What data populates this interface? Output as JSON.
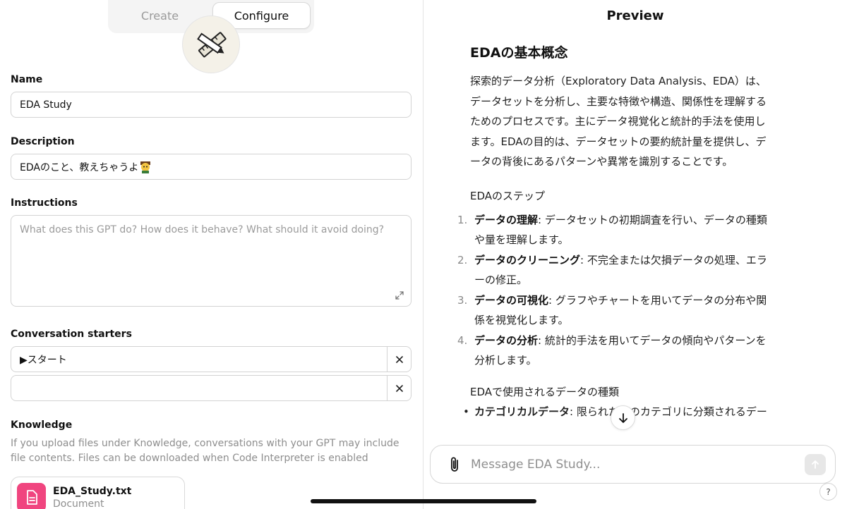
{
  "tabs": {
    "create": "Create",
    "configure": "Configure",
    "active": "Configure"
  },
  "form": {
    "name_label": "Name",
    "name_value": "EDA Study",
    "description_label": "Description",
    "description_value": "EDAのこと、教えちゃうよ",
    "instructions_label": "Instructions",
    "instructions_placeholder": "What does this GPT do? How does it behave? What should it avoid doing?",
    "starters_label": "Conversation starters",
    "starters": [
      "▶︎スタート",
      ""
    ],
    "knowledge_label": "Knowledge",
    "knowledge_desc": "If you upload files under Knowledge, conversations with your GPT may include file contents. Files can be downloaded when Code Interpreter is enabled",
    "file": {
      "name": "EDA_Study.txt",
      "type": "Document"
    }
  },
  "preview": {
    "title": "Preview",
    "heading": "EDAの基本概念",
    "paragraph": "探索的データ分析（Exploratory Data Analysis、EDA）は、データセットを分析し、主要な特徴や構造、関係性を理解するためのプロセスです。主にデータ視覚化と統計的手法を使用します。EDAの目的は、データセットの要約統計量を提供し、データの背後にあるパターンや異常を識別することです。",
    "steps_title": "EDAのステップ",
    "steps": [
      {
        "num": "1.",
        "bold": "データの理解",
        "text": ": データセットの初期調査を行い、データの種類や量を理解します。"
      },
      {
        "num": "2.",
        "bold": "データのクリーニング",
        "text": ": 不完全または欠損データの処理、エラーの修正。"
      },
      {
        "num": "3.",
        "bold": "データの可視化",
        "text": ": グラフやチャートを用いてデータの分布や関係を視覚化します。"
      },
      {
        "num": "4.",
        "bold": "データの分析",
        "text": ": 統計的手法を用いてデータの傾向やパターンを分析します。"
      }
    ],
    "types_title": "EDAで使用されるデータの種類",
    "bullet": {
      "bold": "カテゴリカルデータ",
      "text": ": 限られた数のカテゴリに分類されるデー"
    },
    "message_placeholder": "Message EDA Study...",
    "help": "?"
  },
  "icons": {
    "accent_pink": "#f0457f",
    "avatar": "pencil-ruler-icon",
    "close": "close-icon",
    "expand": "expand-icon",
    "file": "document-icon",
    "scroll": "arrow-down-icon",
    "attach": "paperclip-icon",
    "send": "arrow-up-icon"
  }
}
